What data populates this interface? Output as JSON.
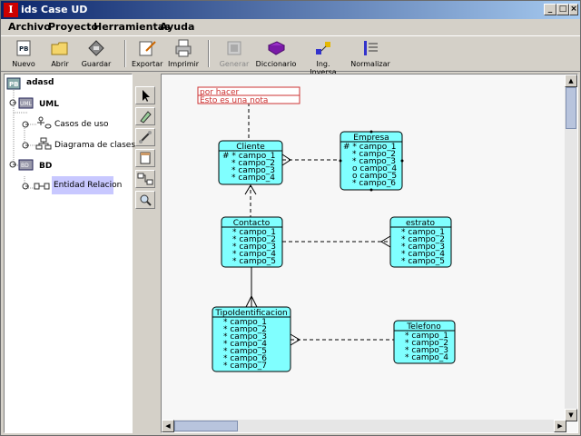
{
  "window": {
    "title": "ids Case UD",
    "icon_letter": "I"
  },
  "menu": [
    "Archivo",
    "Proyecto",
    "Herramientas",
    "Ayuda"
  ],
  "toolbar": [
    {
      "label": "Nuevo",
      "icon": "new-project-icon",
      "enabled": true
    },
    {
      "label": "Abrir",
      "icon": "open-folder-icon",
      "enabled": true
    },
    {
      "label": "Guardar",
      "icon": "save-disk-icon",
      "enabled": true
    },
    {
      "label": "Exportar",
      "icon": "export-icon",
      "enabled": true
    },
    {
      "label": "Imprimir",
      "icon": "printer-icon",
      "enabled": true
    },
    {
      "label": "Generar",
      "icon": "generate-icon",
      "enabled": false
    },
    {
      "label": "Diccionario",
      "icon": "dictionary-book-icon",
      "enabled": true
    },
    {
      "label": "Ing. Inversa",
      "icon": "reverse-engineering-icon",
      "enabled": true
    },
    {
      "label": "Normalizar",
      "icon": "normalize-icon",
      "enabled": true
    }
  ],
  "tree": {
    "root": "adasd",
    "uml": "UML",
    "uml_items": [
      "Casos de uso",
      "Diagrama de clases"
    ],
    "bd": "BD",
    "bd_items": [
      "Entidad Relacion"
    ],
    "selected": "Entidad Relacion"
  },
  "palette": [
    "select-arrow-icon",
    "pencil-icon",
    "link-icon",
    "entity-icon",
    "relation-icon",
    "zoom-icon"
  ],
  "note": {
    "line1": "por hacer",
    "line2": "Esto es una nota"
  },
  "entities": [
    {
      "name": "Cliente",
      "fields": [
        "# * campo_1",
        "* campo_2",
        "* campo_3",
        "* campo_4"
      ]
    },
    {
      "name": "Empresa",
      "fields": [
        "# * campo_1",
        "* campo_2",
        "* campo_3",
        "o campo_4",
        "o campo_5",
        "* campo_6"
      ]
    },
    {
      "name": "Contacto",
      "fields": [
        "* campo_1",
        "* campo_2",
        "* campo_3",
        "* campo_4",
        "* campo_5"
      ]
    },
    {
      "name": "estrato",
      "fields": [
        "* campo_1",
        "* campo_2",
        "* campo_3",
        "* campo_4",
        "* campo_5"
      ]
    },
    {
      "name": "TipoIdentificacion",
      "fields": [
        "* campo_1",
        "* campo_2",
        "* campo_3",
        "* campo_4",
        "* campo_5",
        "* campo_6",
        "* campo_7"
      ]
    },
    {
      "name": "Telefono",
      "fields": [
        "* campo_1",
        "* campo_2",
        "* campo_3",
        "* campo_4"
      ]
    }
  ],
  "colors": {
    "entity_fill": "#80ffff",
    "note_border": "#cc3333",
    "titlebar": "#0a246a",
    "selection": "#c8c8ff"
  }
}
